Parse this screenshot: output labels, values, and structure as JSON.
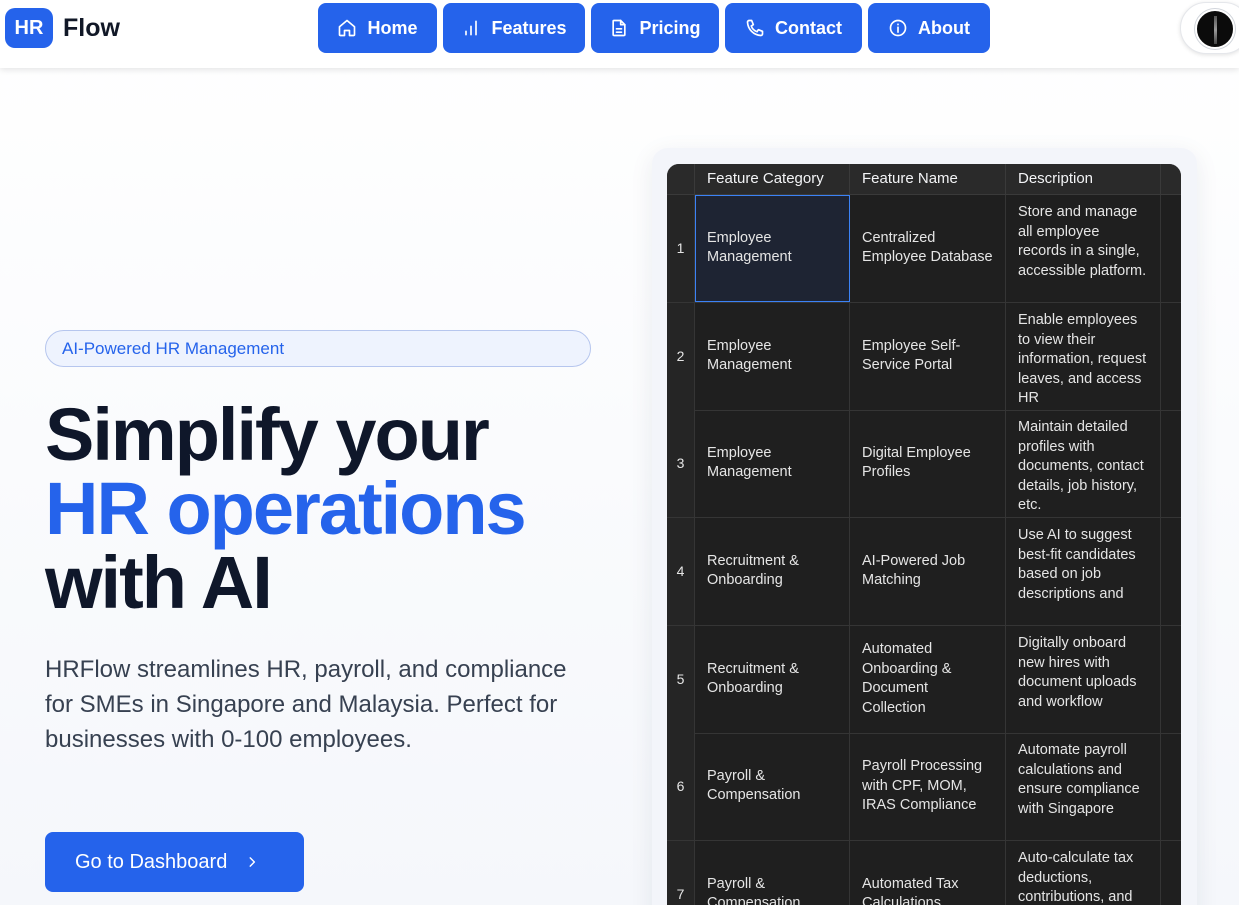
{
  "brand": {
    "badge": "HR",
    "name": "Flow",
    "accent": "#2563eb"
  },
  "nav": [
    {
      "label": "Home",
      "icon": "home-icon"
    },
    {
      "label": "Features",
      "icon": "bar-chart-icon"
    },
    {
      "label": "Pricing",
      "icon": "document-icon"
    },
    {
      "label": "Contact",
      "icon": "phone-icon"
    },
    {
      "label": "About",
      "icon": "info-icon"
    }
  ],
  "hero": {
    "pill": "AI-Powered HR Management",
    "headline_1": "Simplify your",
    "headline_2": "HR operations",
    "headline_3": "with AI",
    "subtext": "HRFlow streamlines HR, payroll, and compliance for SMEs in Singapore and Malaysia. Perfect for businesses with 0-100 employees.",
    "cta": "Go to Dashboard"
  },
  "table": {
    "columns": [
      "Feature Category",
      "Feature Name",
      "Description"
    ],
    "rows": [
      {
        "n": "1",
        "category": "Employee Management",
        "name": "Centralized Employee Database",
        "desc": "Store and manage all employee records in a single, accessible platform."
      },
      {
        "n": "2",
        "category": "Employee Management",
        "name": "Employee Self-Service Portal",
        "desc": "Enable employees to view their information, request leaves, and access HR"
      },
      {
        "n": "3",
        "category": "Employee Management",
        "name": "Digital Employee Profiles",
        "desc": "Maintain detailed profiles with documents, contact details, job history, etc."
      },
      {
        "n": "4",
        "category": "Recruitment & Onboarding",
        "name": "AI-Powered Job Matching",
        "desc": "Use AI to suggest best-fit candidates based on job descriptions and"
      },
      {
        "n": "5",
        "category": "Recruitment & Onboarding",
        "name": "Automated Onboarding & Document Collection",
        "desc": "Digitally onboard new hires with document uploads and workflow"
      },
      {
        "n": "6",
        "category": "Payroll & Compensation",
        "name": "Payroll Processing with CPF, MOM, IRAS Compliance",
        "desc": "Automate payroll calculations and ensure compliance with Singapore"
      },
      {
        "n": "7",
        "category": "Payroll & Compensation",
        "name": "Automated Tax Calculations",
        "desc": "Auto-calculate tax deductions, contributions, and"
      }
    ]
  }
}
